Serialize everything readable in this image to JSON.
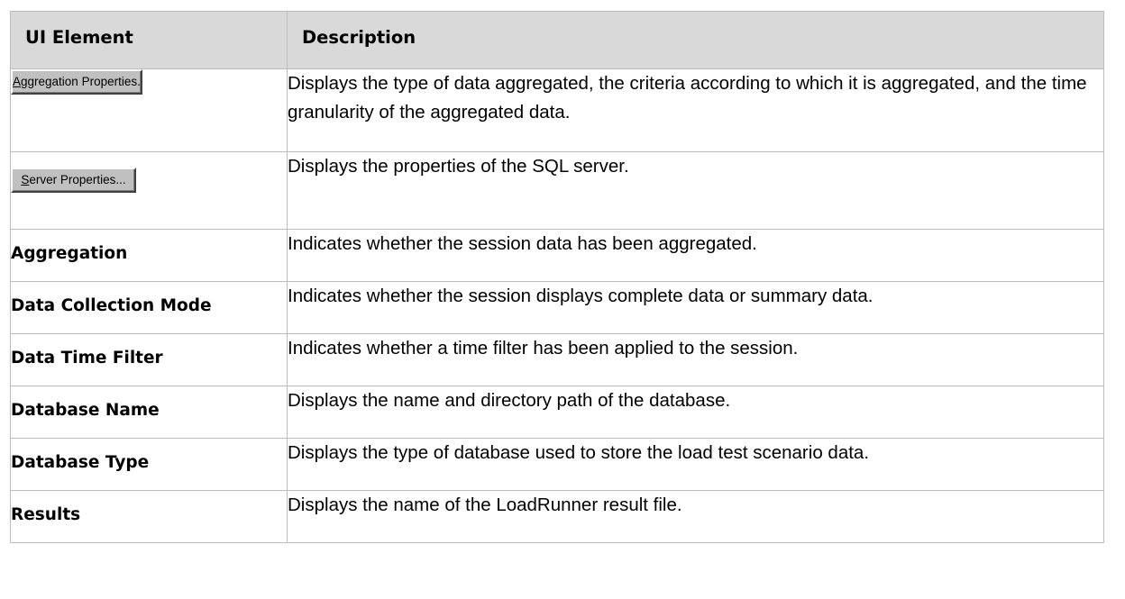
{
  "table": {
    "headers": {
      "ui_element": "UI Element",
      "description": "Description"
    },
    "rows": [
      {
        "button": {
          "mnemonic": "A",
          "rest": "ggregation Properties...",
          "label": "Aggregation Properties..."
        },
        "description": "Displays the type of data aggregated, the criteria according to which it is aggregated, and the time granularity of the aggregated data."
      },
      {
        "button": {
          "mnemonic": "S",
          "rest": "erver Properties...",
          "label": "Server Properties..."
        },
        "description": "Displays the properties of the SQL server."
      },
      {
        "element": "Aggregation",
        "description": "Indicates whether the session data has been aggregated."
      },
      {
        "element": "Data Collection Mode",
        "description": "Indicates whether the session displays complete data or summary data."
      },
      {
        "element": "Data Time Filter",
        "description": "Indicates whether a time filter has been applied to the session."
      },
      {
        "element": "Database Name",
        "description": "Displays the name and directory path of the database."
      },
      {
        "element": "Database Type",
        "description": "Displays the type of database used to store the load test scenario data."
      },
      {
        "element": "Results",
        "description": "Displays the name of the LoadRunner result file."
      }
    ]
  }
}
